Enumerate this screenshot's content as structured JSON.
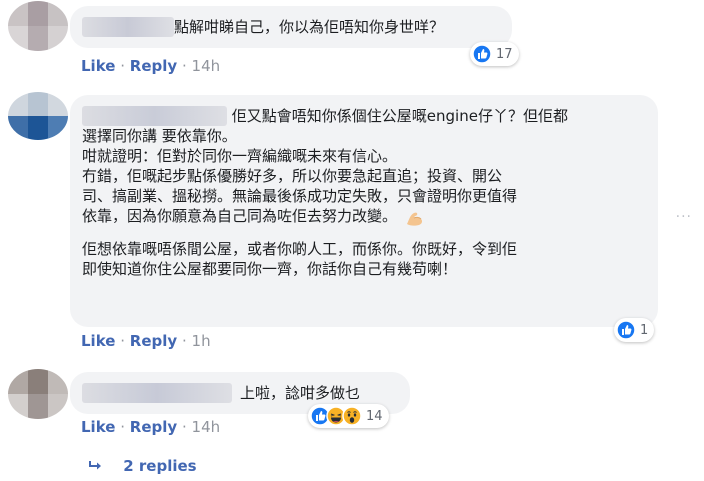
{
  "comments": [
    {
      "text": "點解咁睇自己，你以為佢唔知你身世咩？",
      "actions": {
        "like": "Like",
        "reply": "Reply",
        "sep": "·",
        "time": "14h"
      },
      "reaction_count": "17"
    },
    {
      "paragraphs": [
        "佢又點會唔知你係個住公屋嘅engine仔丫？但佢都\n選擇同你講 要依靠你。",
        "咁就證明：佢對於同你一齊編織嘅未來有信心。\n冇錯，佢嘅起步點係優勝好多，所以你要急起直追；投資、開公\n司、搞副業、搵秘撈。無論最後係成功定失敗，只會證明你更值得\n依靠，因為你願意為自己同為咗佢去努力改變。",
        "佢想依靠嘅唔係間公屋，或者你啲人工，而係你。你既好，令到佢\n即使知道你住公屋都要同你一齊，你話你自己有幾苟喇！"
      ],
      "actions": {
        "like": "Like",
        "reply": "Reply",
        "sep": "·",
        "time": "1h"
      },
      "reaction_count": "1"
    },
    {
      "text": "上啦，諗咁多做乜",
      "actions": {
        "like": "Like",
        "reply": "Reply",
        "sep": "·",
        "time": "14h"
      },
      "reaction_count": "14"
    }
  ],
  "replies_link": "2 replies",
  "more_options": "···",
  "colors": {
    "link": "#4267b2",
    "like_blue": "#1877f2",
    "bubble_bg": "#f2f3f5",
    "meta_gray": "#90949c",
    "haha_yellow": "#f7b125",
    "flex_skin": "#f4c48f"
  },
  "icons": {
    "like": "thumbs-up-icon",
    "haha": "haha-emoji-icon",
    "wow": "wow-emoji-icon",
    "flex": "flexed-biceps-emoji",
    "reply_arrow": "reply-arrow-icon"
  }
}
